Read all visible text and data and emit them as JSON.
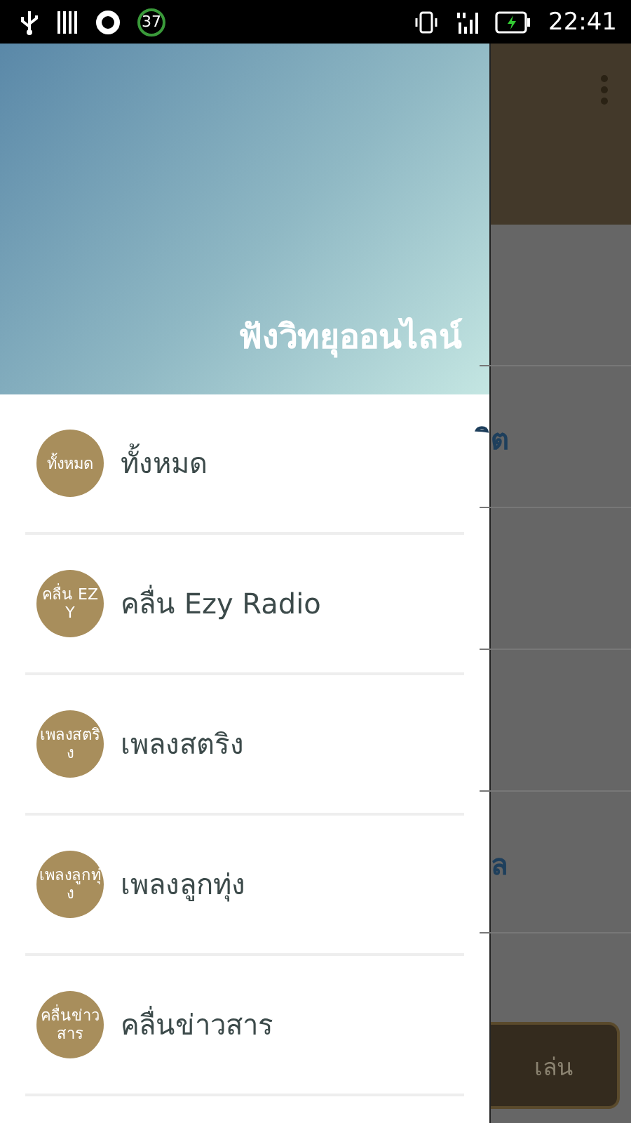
{
  "status_bar": {
    "notification_count": "37",
    "time": "22:41"
  },
  "drawer": {
    "title": "ฟังวิทยุออนไลน์",
    "items": [
      {
        "badge": "ทั้งหมด",
        "label": "ทั้งหมด"
      },
      {
        "badge": "คลื่น EZY",
        "label": "คลื่น Ezy Radio"
      },
      {
        "badge": "เพลงสตริง",
        "label": "เพลงสตริง"
      },
      {
        "badge": "เพลงลูกทุ่ง",
        "label": "เพลงลูกทุ่ง"
      },
      {
        "badge": "คลื่นข่าวสาร",
        "label": "คลื่นข่าวสาร"
      }
    ]
  },
  "background": {
    "rows": [
      {
        "text": ""
      },
      {
        "text": "ิต"
      },
      {
        "text": ""
      },
      {
        "text": ""
      },
      {
        "text": "ล"
      }
    ],
    "play_button": "เล่น"
  }
}
